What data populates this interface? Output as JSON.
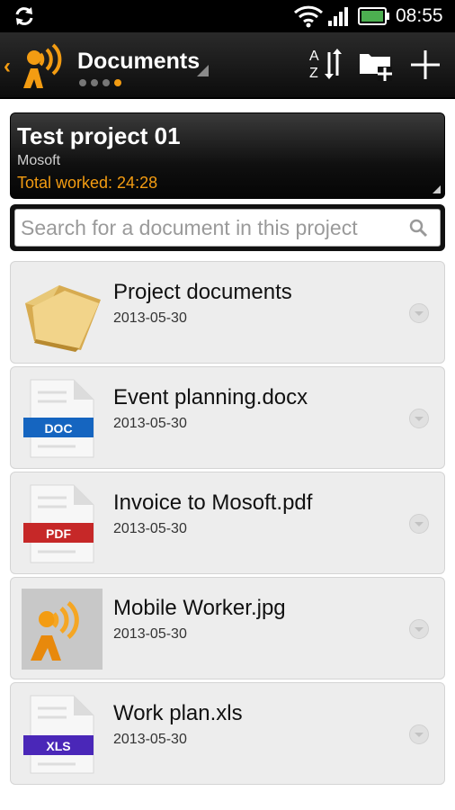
{
  "status_bar": {
    "time": "08:55",
    "icons": [
      "sync-icon",
      "wifi-icon",
      "signal-icon",
      "battery-icon"
    ]
  },
  "app_bar": {
    "title": "Documents",
    "pages_count": 4,
    "active_page": 4,
    "actions": [
      "sort-az-icon",
      "new-folder-icon",
      "add-icon"
    ]
  },
  "project": {
    "name": "Test project 01",
    "company": "Mosoft",
    "total_worked": "Total worked: 24:28"
  },
  "search": {
    "placeholder": "Search for a document in this project",
    "value": ""
  },
  "documents": [
    {
      "name": "Project documents",
      "date": "2013-05-30",
      "icon": "folder-icon"
    },
    {
      "name": "Event planning.docx",
      "date": "2013-05-30",
      "icon": "doc-file-icon",
      "badge": "DOC"
    },
    {
      "name": "Invoice to Mosoft.pdf",
      "date": "2013-05-30",
      "icon": "pdf-file-icon",
      "badge": "PDF"
    },
    {
      "name": "Mobile Worker.jpg",
      "date": "2013-05-30",
      "icon": "image-thumbnail"
    },
    {
      "name": "Work plan.xls",
      "date": "2013-05-30",
      "icon": "xls-file-icon",
      "badge": "XLS"
    }
  ],
  "colors": {
    "accent": "#f39c12",
    "doc_badge": "#1565c0",
    "pdf_badge": "#c62828",
    "xls_badge": "#4a27b8"
  }
}
